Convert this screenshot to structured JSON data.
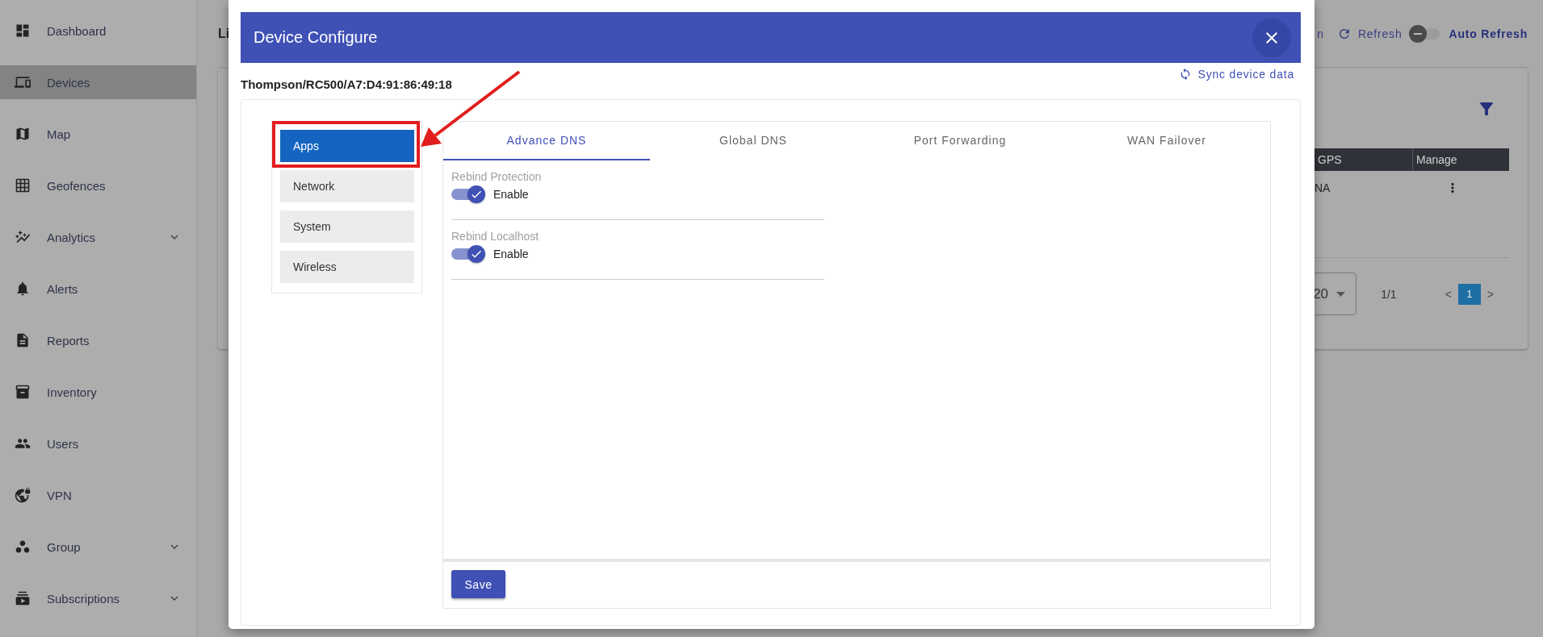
{
  "sidebar": {
    "items": [
      {
        "label": "Dashboard",
        "selected": false,
        "has_submenu": false
      },
      {
        "label": "Devices",
        "selected": true,
        "has_submenu": false
      },
      {
        "label": "Map",
        "selected": false,
        "has_submenu": false
      },
      {
        "label": "Geofences",
        "selected": false,
        "has_submenu": false
      },
      {
        "label": "Analytics",
        "selected": false,
        "has_submenu": true
      },
      {
        "label": "Alerts",
        "selected": false,
        "has_submenu": false
      },
      {
        "label": "Reports",
        "selected": false,
        "has_submenu": false
      },
      {
        "label": "Inventory",
        "selected": false,
        "has_submenu": false
      },
      {
        "label": "Users",
        "selected": false,
        "has_submenu": false
      },
      {
        "label": "VPN",
        "selected": false,
        "has_submenu": false
      },
      {
        "label": "Group",
        "selected": false,
        "has_submenu": true
      },
      {
        "label": "Subscriptions",
        "selected": false,
        "has_submenu": true
      }
    ]
  },
  "page": {
    "title_fragment": "Li",
    "toolbar": {
      "cut_text": "n",
      "refresh": "Refresh",
      "auto_refresh": {
        "label": "Auto Refresh",
        "on": false
      }
    }
  },
  "devices_card": {
    "columns": [
      "GPS",
      "Manage"
    ],
    "rows": [
      {
        "gps": "NA"
      }
    ],
    "page_size": "20",
    "page_count": "1/1",
    "prev": "<",
    "next": ">",
    "pages": [
      {
        "label": "1",
        "selected": true
      }
    ]
  },
  "modal": {
    "title": "Device Configure",
    "device": "Thompson/RC500/A7:D4:91:86:49:18",
    "sync_link": "Sync device data",
    "categories": [
      {
        "label": "Apps",
        "selected": true
      },
      {
        "label": "Network",
        "selected": false
      },
      {
        "label": "System",
        "selected": false
      },
      {
        "label": "Wireless",
        "selected": false
      }
    ],
    "tabs": [
      {
        "label": "Advance DNS",
        "selected": true
      },
      {
        "label": "Global DNS",
        "selected": false
      },
      {
        "label": "Port Forwarding",
        "selected": false
      },
      {
        "label": "WAN Failover",
        "selected": false
      }
    ],
    "settings": [
      {
        "label": "Rebind Protection",
        "option": "Enable",
        "on": true
      },
      {
        "label": "Rebind Localhost",
        "option": "Enable",
        "on": true
      }
    ],
    "save": "Save"
  }
}
